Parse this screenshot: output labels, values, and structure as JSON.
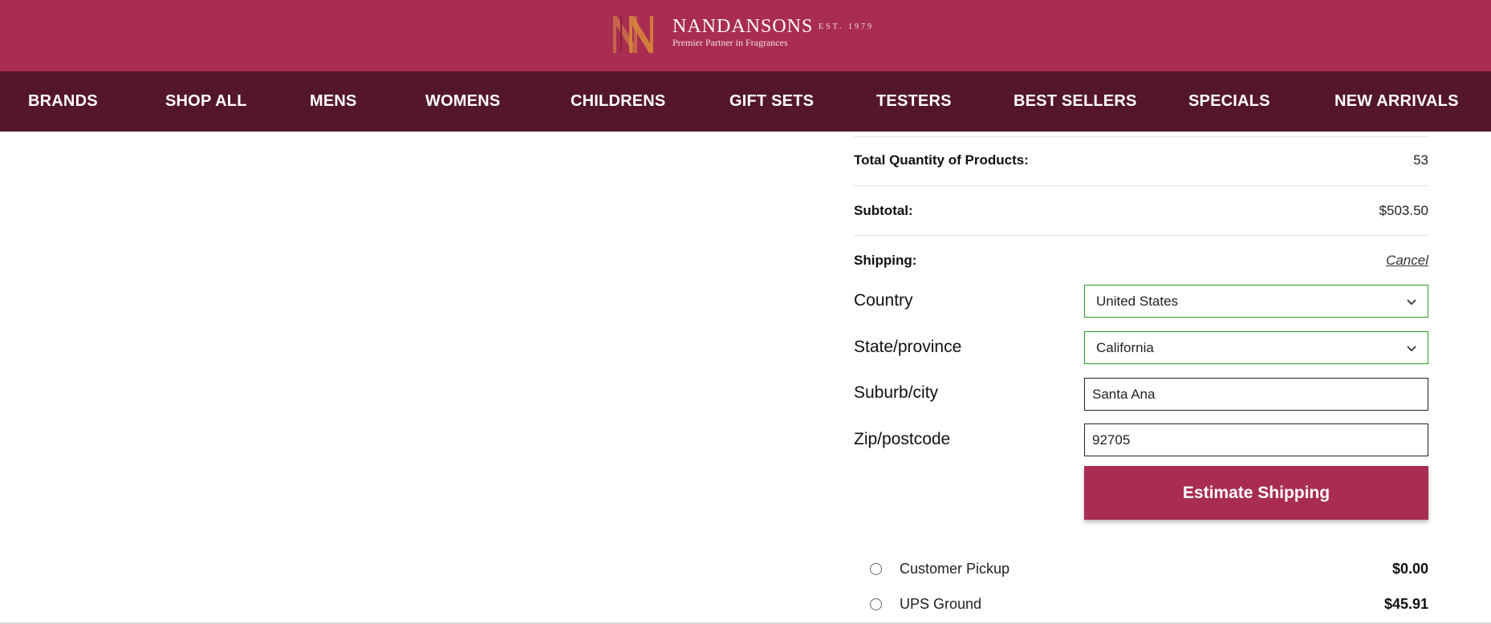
{
  "brand": {
    "name": "NANDANSONS",
    "tagline": "Premier Partner in Fragrances",
    "established": "EST. 1979",
    "header_color": "#a82d51",
    "nav_color": "#541729"
  },
  "nav": {
    "items": [
      {
        "label": "BRANDS"
      },
      {
        "label": "SHOP ALL"
      },
      {
        "label": "MENS"
      },
      {
        "label": "WOMENS"
      },
      {
        "label": "CHILDRENS"
      },
      {
        "label": "GIFT SETS"
      },
      {
        "label": "TESTERS"
      },
      {
        "label": "BEST SELLERS"
      },
      {
        "label": "SPECIALS"
      },
      {
        "label": "NEW ARRIVALS"
      }
    ]
  },
  "cart_summary": {
    "total_quantity_label": "Total Quantity of Products:",
    "total_quantity_value": "53",
    "subtotal_label": "Subtotal:",
    "subtotal_value": "$503.50",
    "shipping_label": "Shipping:",
    "cancel_label": "Cancel"
  },
  "shipping_form": {
    "country_label": "Country",
    "country_value": "United States",
    "state_label": "State/province",
    "state_value": "California",
    "city_label": "Suburb/city",
    "city_value": "Santa Ana",
    "zip_label": "Zip/postcode",
    "zip_value": "92705",
    "estimate_button": "Estimate Shipping"
  },
  "shipping_options": [
    {
      "label": "Customer Pickup",
      "price": "$0.00",
      "selected": false
    },
    {
      "label": "UPS Ground",
      "price": "$45.91",
      "selected": false
    }
  ],
  "icons": {
    "chevron": "chevron-down-icon",
    "logo": "nn-monogram-logo"
  }
}
